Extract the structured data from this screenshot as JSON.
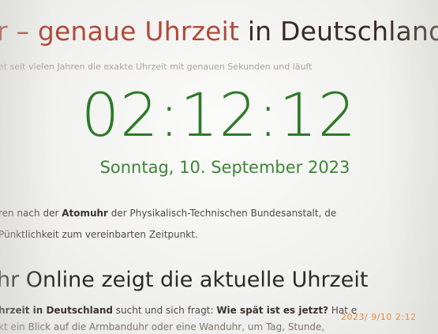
{
  "page": {
    "headline_prefix": "r – ",
    "headline_accent": "genaue Uhrzeit",
    "headline_tail": " in Deutschland",
    "intro": "et seit vielen Jahren die exakte Uhrzeit mit genauen Sekunden und läuft",
    "time": "02:12:12",
    "date": "Sonntag, 10. September 2023",
    "para1_before": "ren nach der ",
    "para1_bold": "Atomuhr",
    "para1_after": " der Physikalisch-Technischen Bundesanstalt, de",
    "para2": "Pünktlichkeit zum vereinbarten Zeitpunkt.",
    "subheading": "hr Online zeigt die aktuelle Uhrzeit",
    "para3_bold1": "hrzeit in Deutschland",
    "para3_mid": " sucht und sich fragt: ",
    "para3_bold2": "Wie spät ist es jetzt?",
    "para3_after": " Hat e",
    "para4": "kt ein Blick auf die Armbanduhr oder eine Wanduhr, um Tag, Stunde,",
    "camera_stamp": "2023/ 9/10  2:12"
  },
  "colors": {
    "clock_green": "#2f7a2a",
    "headline_red": "#b04a3a",
    "stamp_orange": "#e88a3a"
  }
}
